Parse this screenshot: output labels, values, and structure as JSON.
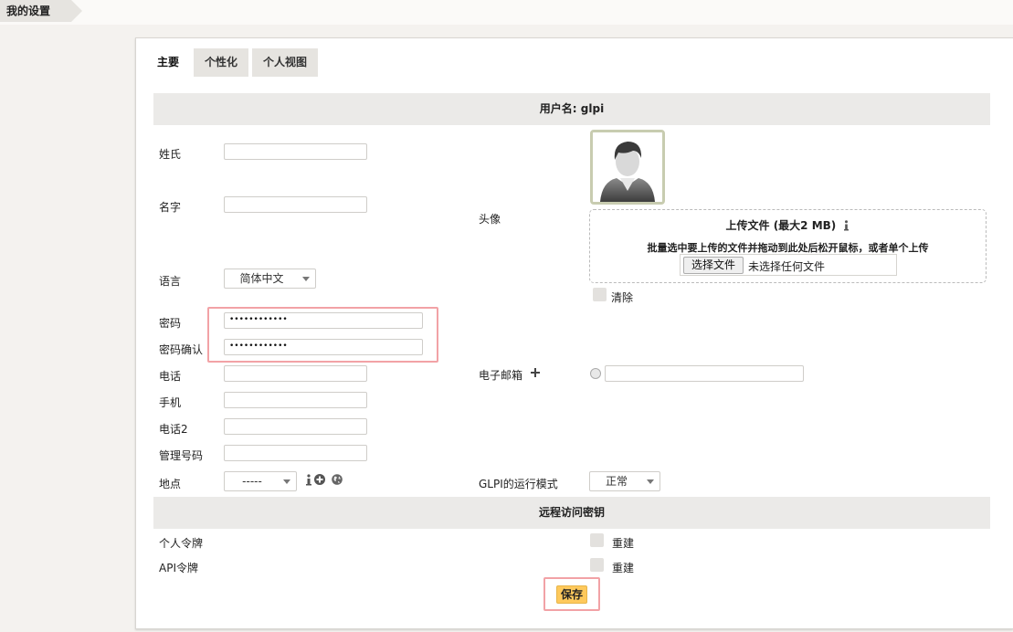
{
  "breadcrumb": {
    "title": "我的设置"
  },
  "tabs": [
    {
      "label": "主要"
    },
    {
      "label": "个性化"
    },
    {
      "label": "个人视图"
    }
  ],
  "header": {
    "username_label": "用户名: glpi"
  },
  "form": {
    "surname_label": "姓氏",
    "surname_value": "",
    "firstname_label": "名字",
    "firstname_value": "",
    "language_label": "语言",
    "language_value": "简体中文",
    "password_label": "密码",
    "password_value": "••••••••••••",
    "password_confirm_label": "密码确认",
    "password_confirm_value": "••••••••••••",
    "phone_label": "电话",
    "phone_value": "",
    "mobile_label": "手机",
    "mobile_value": "",
    "phone2_label": "电话2",
    "phone2_value": "",
    "admin_number_label": "管理号码",
    "admin_number_value": "",
    "location_label": "地点",
    "location_value": "-----",
    "avatar_label": "头像",
    "upload_title": "上传文件 (最大2 MB)",
    "upload_hint": "批量选中要上传的文件并拖动到此处后松开鼠标，或者单个上传",
    "choose_file_button": "选择文件",
    "no_file_text": "未选择任何文件",
    "clear_label": "清除",
    "email_label": "电子邮箱",
    "email_value": "",
    "glpi_mode_label": "GLPI的运行模式",
    "glpi_mode_value": "正常"
  },
  "remote_access": {
    "header": "远程访问密钥",
    "personal_token_label": "个人令牌",
    "personal_regenerate_label": "重建",
    "api_token_label": "API令牌",
    "api_regenerate_label": "重建"
  },
  "save_button": "保存",
  "icons": {
    "info": "info-icon",
    "add": "plus-circle-icon",
    "globe": "globe-icon",
    "email_add": "plus-icon"
  },
  "colors": {
    "accent_save": "#fec95c",
    "highlight_box": "#f2a2a6",
    "section_header": "#ebeae8"
  }
}
